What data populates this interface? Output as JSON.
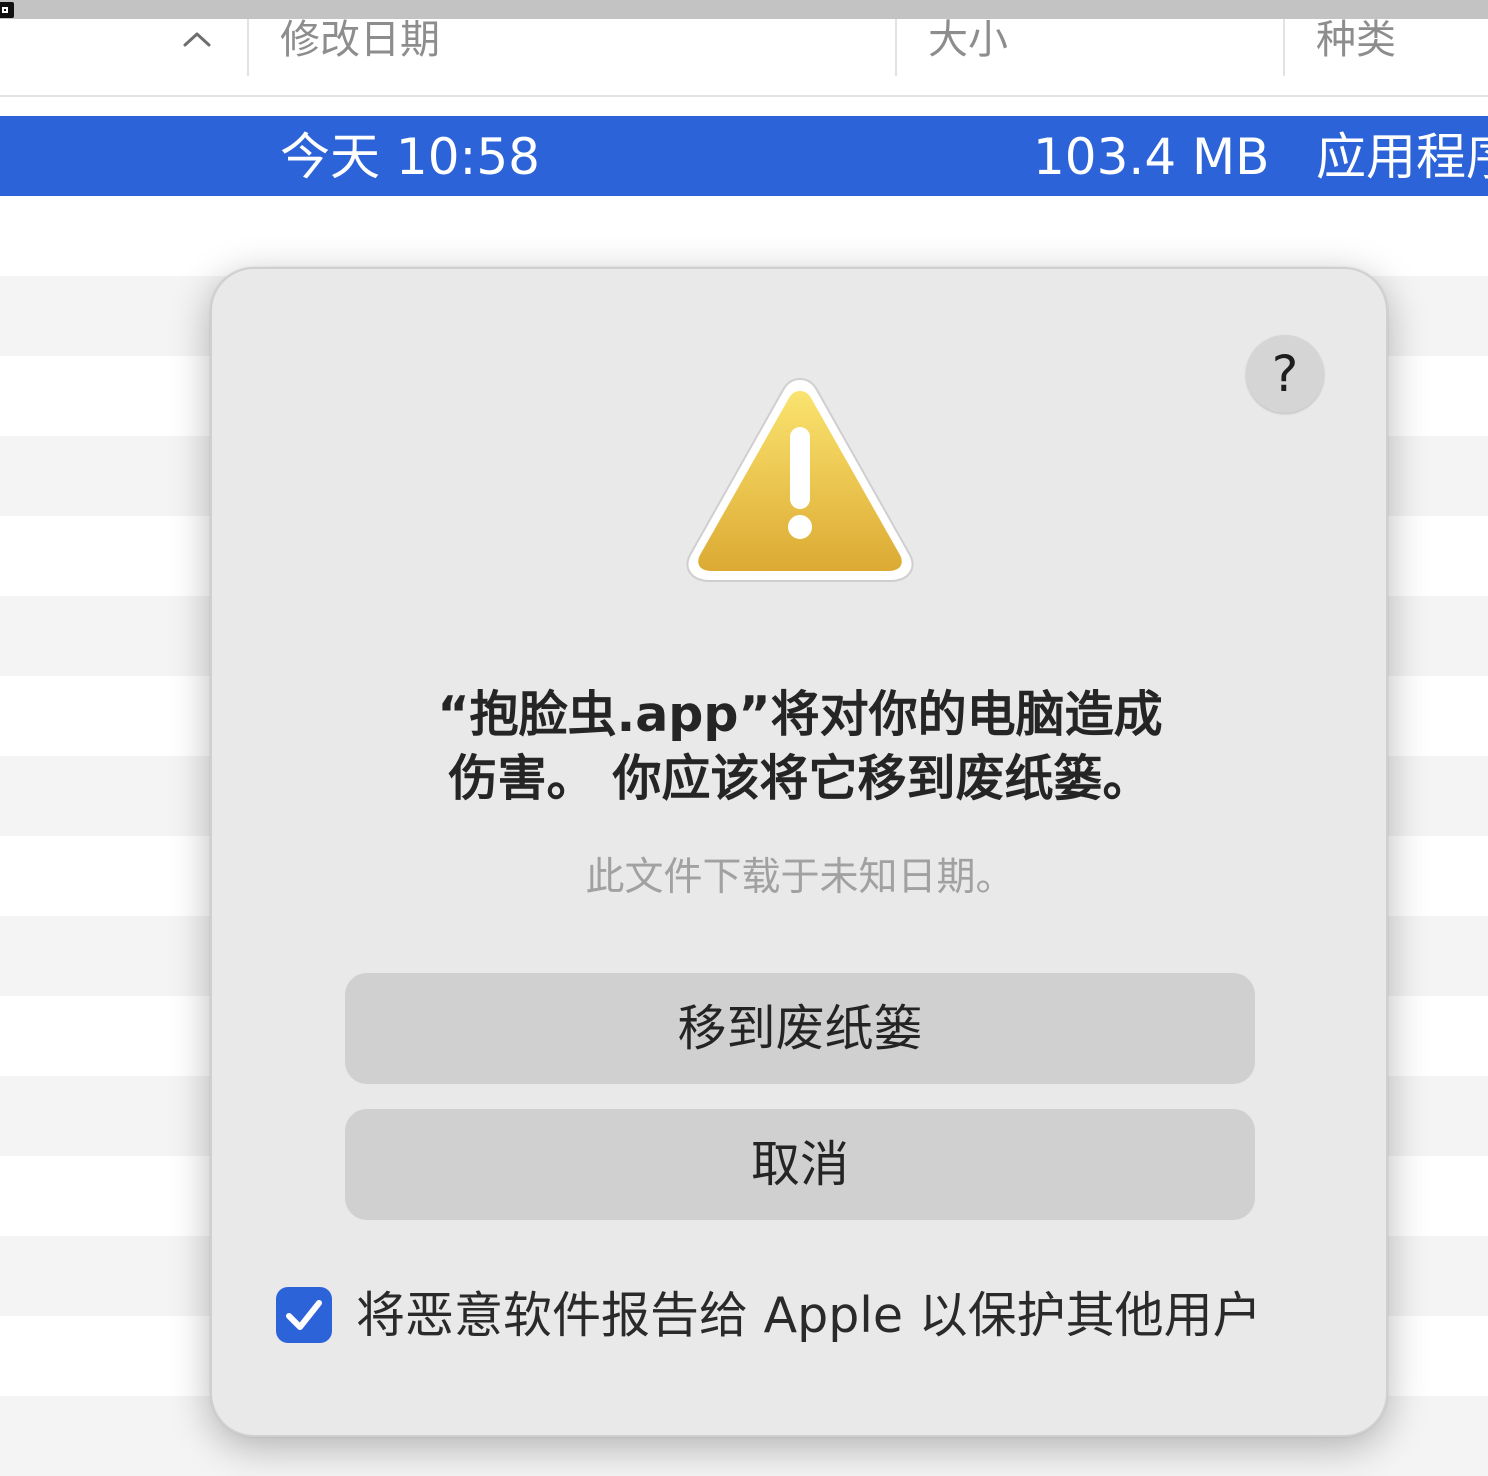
{
  "colors": {
    "selection": "#2c63d8",
    "dialog_bg": "#e9e9e9",
    "button_bg": "#d0d0d0",
    "warning_yellow": "#f2cc4a"
  },
  "header": {
    "sort_icon": "chevron-up-icon",
    "col_date": "修改日期",
    "col_size": "大小",
    "col_kind": "种类"
  },
  "selected_row": {
    "date": "今天 10:58",
    "size": "103.4 MB",
    "kind": "应用程序"
  },
  "dialog": {
    "help_label": "?",
    "icon": "warning-icon",
    "title_line1": "“抱脸虫.app”将对你的电脑造成",
    "title_line2": "伤害。 你应该将它移到废纸篓。",
    "subtitle": "此文件下载于未知日期。",
    "trash_button": "移到废纸篓",
    "cancel_button": "取消",
    "report_checkbox": {
      "checked": true,
      "label": "将恶意软件报告给 Apple 以保护其他用户"
    }
  }
}
